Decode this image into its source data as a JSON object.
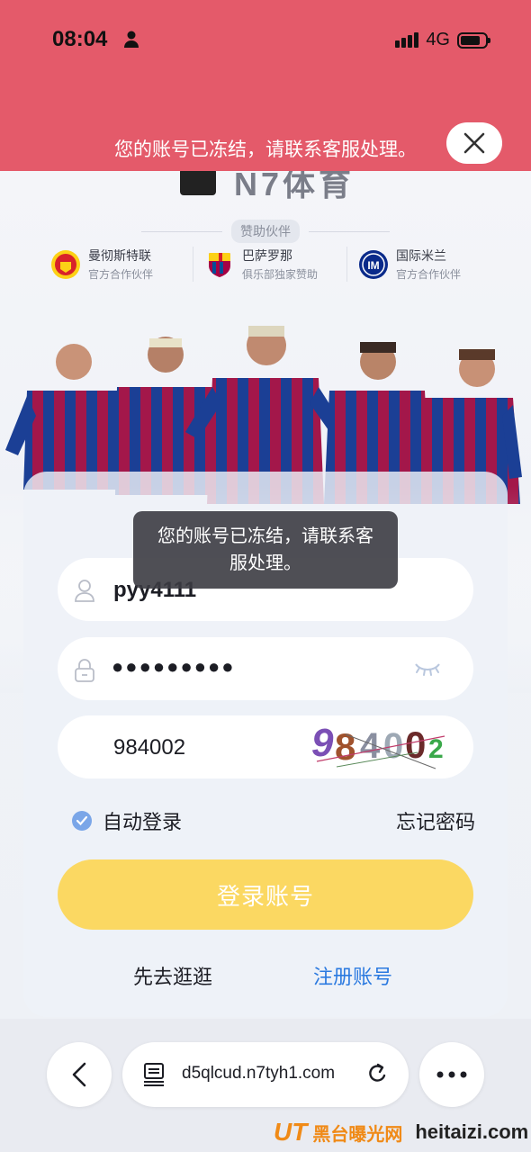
{
  "status_bar": {
    "time": "08:04",
    "network": "4G",
    "battery_level": 0.8
  },
  "banner": {
    "message": "您的账号已冻结，请联系客服处理。"
  },
  "logo": {
    "text": "N7体育"
  },
  "sponsors": {
    "title": "赞助伙伴",
    "items": [
      {
        "name": "曼彻斯特联",
        "sub": "官方合作伙伴",
        "color": "#d8222a"
      },
      {
        "name": "巴萨罗那",
        "sub": "俱乐部独家赞助",
        "color": "#a50044"
      },
      {
        "name": "国际米兰",
        "sub": "官方合作伙伴",
        "color": "#0a2a8a"
      }
    ]
  },
  "toast": {
    "message": "您的账号已冻结，请联系客服处理。"
  },
  "form": {
    "username": "pyy4111",
    "password": "●●●●●●●●●",
    "captcha": "984002",
    "captcha_image_text": "984002",
    "remember_label": "自动登录",
    "forgot_label": "忘记密码",
    "login_label": "登录账号",
    "browse_label": "先去逛逛",
    "register_label": "注册账号"
  },
  "browser": {
    "url": "d5qlcud.n7tyh1.com"
  },
  "watermark": {
    "logo": "UT",
    "cn": "黑台曝光网",
    "en": "heitaizi.com"
  },
  "colors": {
    "banner": "#e45a6a",
    "login_button": "#fbd862",
    "link": "#2b7ae0"
  }
}
